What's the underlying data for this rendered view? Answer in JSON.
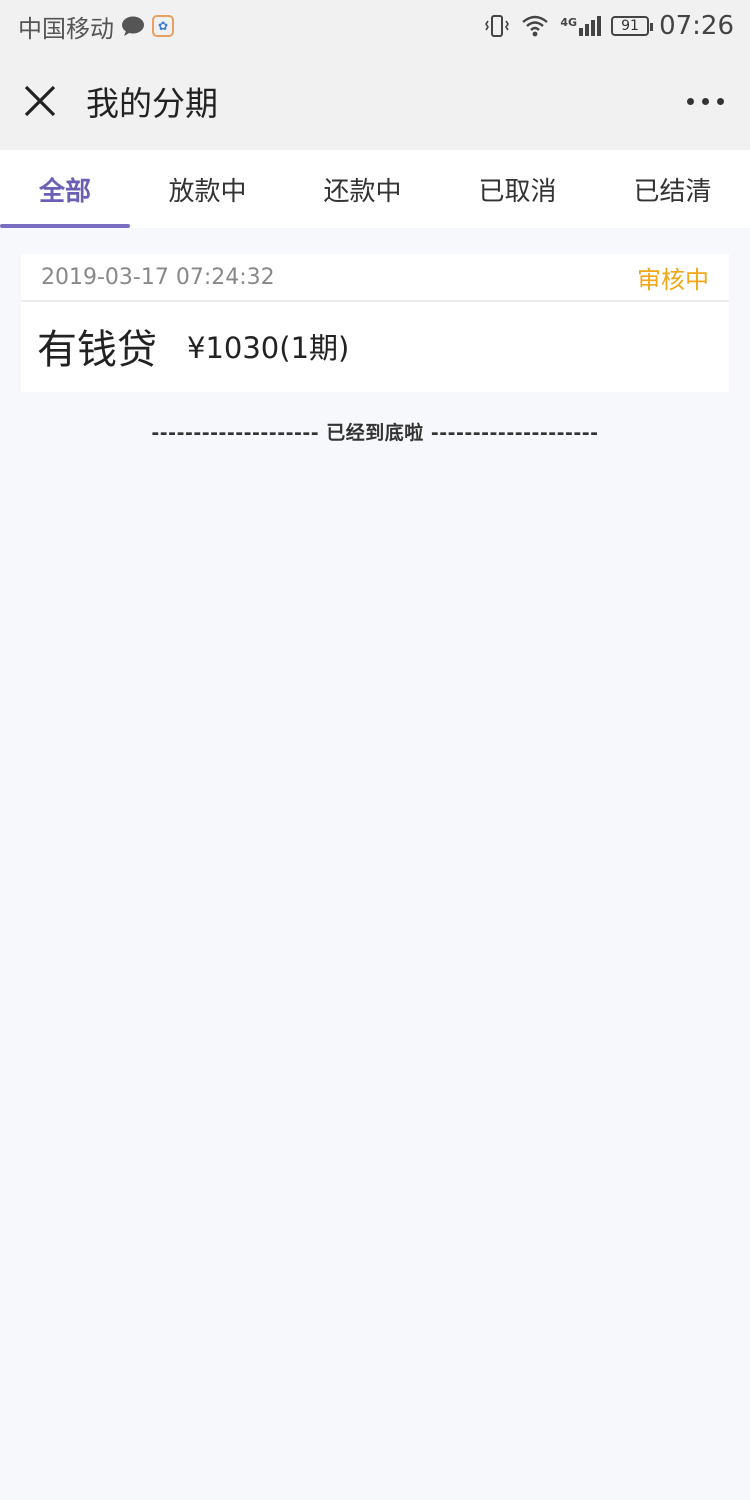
{
  "status_bar": {
    "carrier": "中国移动",
    "network": "4G",
    "battery": "91",
    "time": "07:26"
  },
  "header": {
    "title": "我的分期"
  },
  "tabs": [
    {
      "label": "全部",
      "active": true
    },
    {
      "label": "放款中",
      "active": false
    },
    {
      "label": "还款中",
      "active": false
    },
    {
      "label": "已取消",
      "active": false
    },
    {
      "label": "已结清",
      "active": false
    }
  ],
  "orders": [
    {
      "date": "2019-03-17 07:24:32",
      "status": "审核中",
      "product": "有钱贷",
      "amount": "¥1030(1期)"
    }
  ],
  "end_text": "-------------------- 已经到底啦 --------------------",
  "colors": {
    "accent": "#6b5fb5",
    "status_pending": "#f0a818",
    "background": "#f7f8fc"
  }
}
